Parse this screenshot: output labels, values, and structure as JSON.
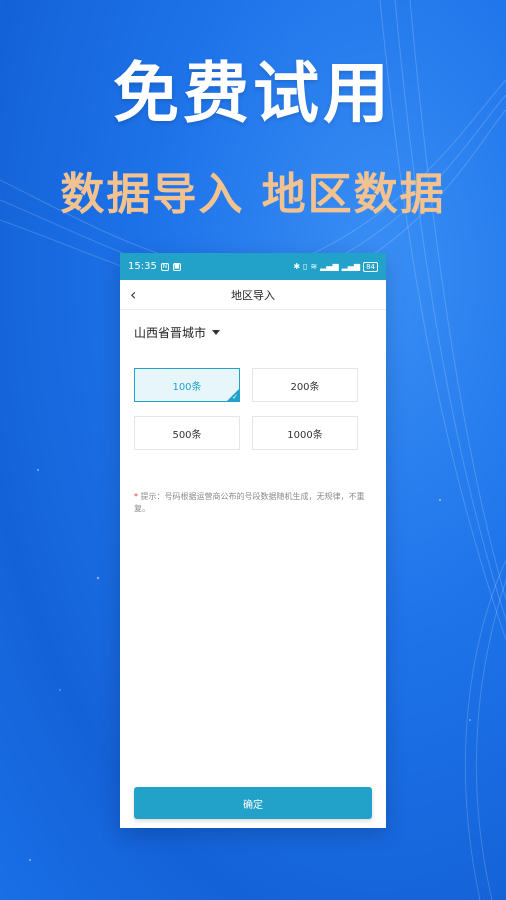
{
  "promo": {
    "headline": "免费试用",
    "subheadline": "数据导入 地区数据"
  },
  "statusbar": {
    "time": "15:35",
    "battery": "84"
  },
  "navbar": {
    "back_icon": "‹",
    "title": "地区导入"
  },
  "region": {
    "label": "山西省晋城市"
  },
  "options": [
    {
      "label": "100条",
      "selected": true
    },
    {
      "label": "200条",
      "selected": false
    },
    {
      "label": "500条",
      "selected": false
    },
    {
      "label": "1000条",
      "selected": false
    }
  ],
  "tip": {
    "star": "*",
    "text": " 提示：号码根据运营商公布的号段数据随机生成，无规律，不重复。"
  },
  "confirm_label": "确定",
  "colors": {
    "accent": "#23a2c9",
    "promo_sub": "#f2c290",
    "background": "#1f74ea"
  }
}
